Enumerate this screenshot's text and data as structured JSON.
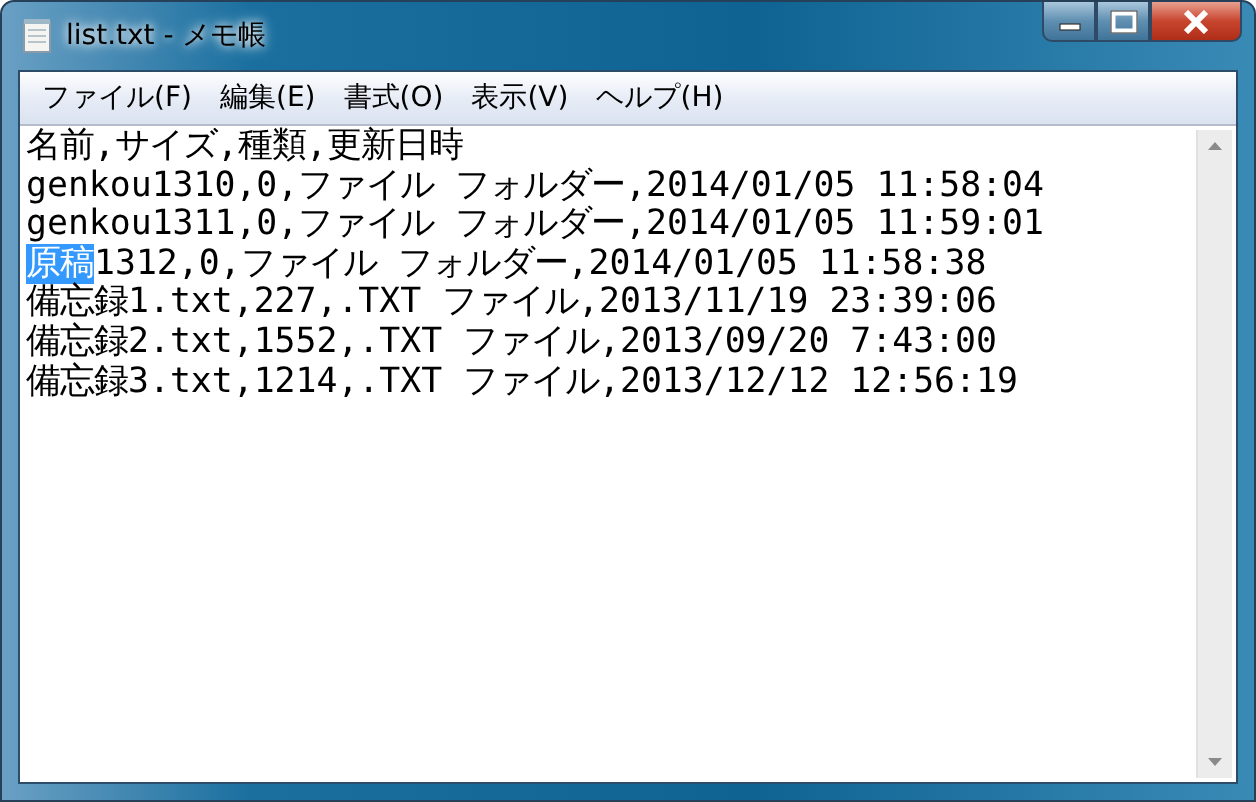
{
  "window": {
    "title": "list.txt - メモ帳"
  },
  "menu": [
    "ファイル(F)",
    "編集(E)",
    "書式(O)",
    "表示(V)",
    "ヘルプ(H)"
  ],
  "lines": [
    {
      "segments": [
        {
          "text": "名前,サイズ,種類,更新日時",
          "selected": false
        }
      ]
    },
    {
      "segments": [
        {
          "text": "genkou1310,0,ファイル フォルダー,2014/01/05 11:58:04",
          "selected": false
        }
      ]
    },
    {
      "segments": [
        {
          "text": "genkou1311,0,ファイル フォルダー,2014/01/05 11:59:01",
          "selected": false
        }
      ]
    },
    {
      "segments": [
        {
          "text": "原稿",
          "selected": true
        },
        {
          "text": "1312,0,ファイル フォルダー,2014/01/05 11:58:38",
          "selected": false
        }
      ]
    },
    {
      "segments": [
        {
          "text": "備忘録1.txt,227,.TXT ファイル,2013/11/19 23:39:06",
          "selected": false
        }
      ]
    },
    {
      "segments": [
        {
          "text": "備忘録2.txt,1552,.TXT ファイル,2013/09/20 7:43:00",
          "selected": false
        }
      ]
    },
    {
      "segments": [
        {
          "text": "備忘録3.txt,1214,.TXT ファイル,2013/12/12 12:56:19",
          "selected": false
        }
      ]
    }
  ]
}
